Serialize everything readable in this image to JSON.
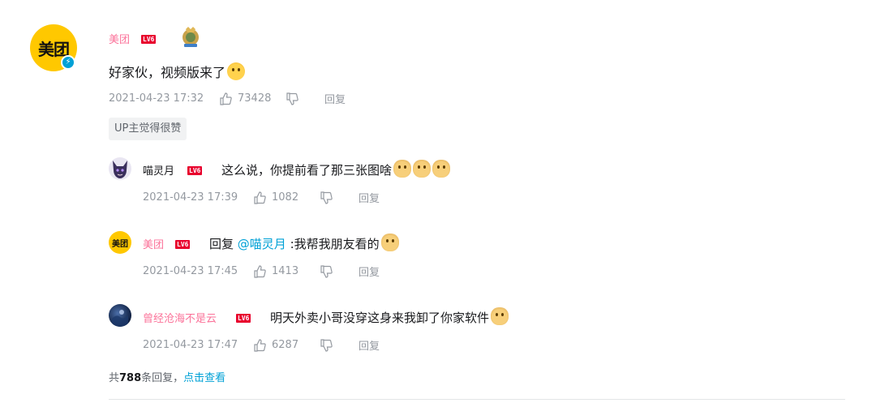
{
  "main_comment": {
    "avatar_text": "美团",
    "username": "美团",
    "level": "LV6",
    "text": "好家伙，视频版来了",
    "time": "2021-04-23 17:32",
    "likes": "73428",
    "reply_label": "回复",
    "up_badge": "UP主觉得很赞"
  },
  "replies": [
    {
      "username": "喵灵月",
      "level": "LV6",
      "text": "这么说，你提前看了那三张图啥",
      "time": "2021-04-23 17:39",
      "likes": "1082",
      "reply_label": "回复"
    },
    {
      "avatar_text": "美团",
      "username": "美团",
      "level": "LV6",
      "reply_prefix": "回复 ",
      "mention": "@喵灵月",
      "text": " :我帮我朋友看的",
      "time": "2021-04-23 17:45",
      "likes": "1413",
      "reply_label": "回复"
    },
    {
      "username": "曾经沧海不是云",
      "level": "LV6",
      "text": "明天外卖小哥没穿这身来我卸了你家软件",
      "time": "2021-04-23 17:47",
      "likes": "6287",
      "reply_label": "回复"
    }
  ],
  "footer": {
    "prefix": "共",
    "count": "788",
    "suffix": "条回复，",
    "view_link": "点击查看"
  },
  "colors": {
    "username_pink": "#fb7299",
    "link_blue": "#00a1d6",
    "meta_gray": "#9499a0",
    "level_red": "#e8002d",
    "brand_yellow": "#ffc800"
  },
  "icons": {
    "like": "thumbs-up-icon",
    "dislike": "thumbs-down-icon",
    "verify": "lightning-verified-icon",
    "medal": "medal-icon"
  }
}
